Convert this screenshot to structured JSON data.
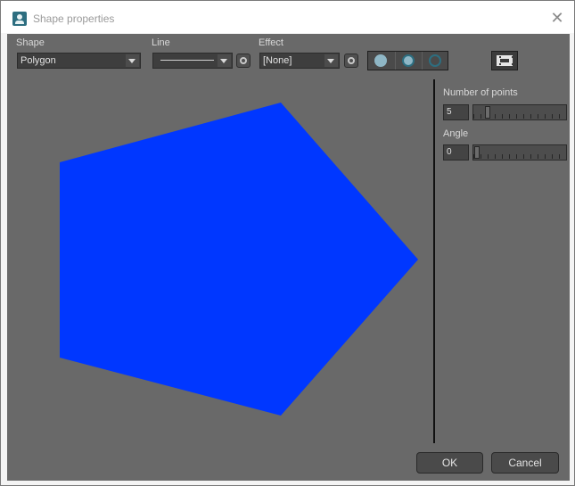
{
  "window": {
    "title": "Shape properties"
  },
  "toolbar": {
    "shape": {
      "label": "Shape",
      "value": "Polygon"
    },
    "line": {
      "label": "Line"
    },
    "effect": {
      "label": "Effect",
      "value": "[None]"
    },
    "fill_modes": [
      "filled-circle-icon",
      "filled-outlined-circle-icon",
      "outlined-circle-icon"
    ],
    "colors": {
      "fill_mode_active": "#8fb7c6",
      "outline": "#2d6e80"
    }
  },
  "properties": {
    "number_of_points": {
      "label": "Number of points",
      "value": "5",
      "fraction": 0.13
    },
    "angle": {
      "label": "Angle",
      "value": "0",
      "fraction": 0.0
    }
  },
  "preview": {
    "shape": "pentagon",
    "fill_color": "#0037ff"
  },
  "buttons": {
    "ok": "OK",
    "cancel": "Cancel"
  }
}
